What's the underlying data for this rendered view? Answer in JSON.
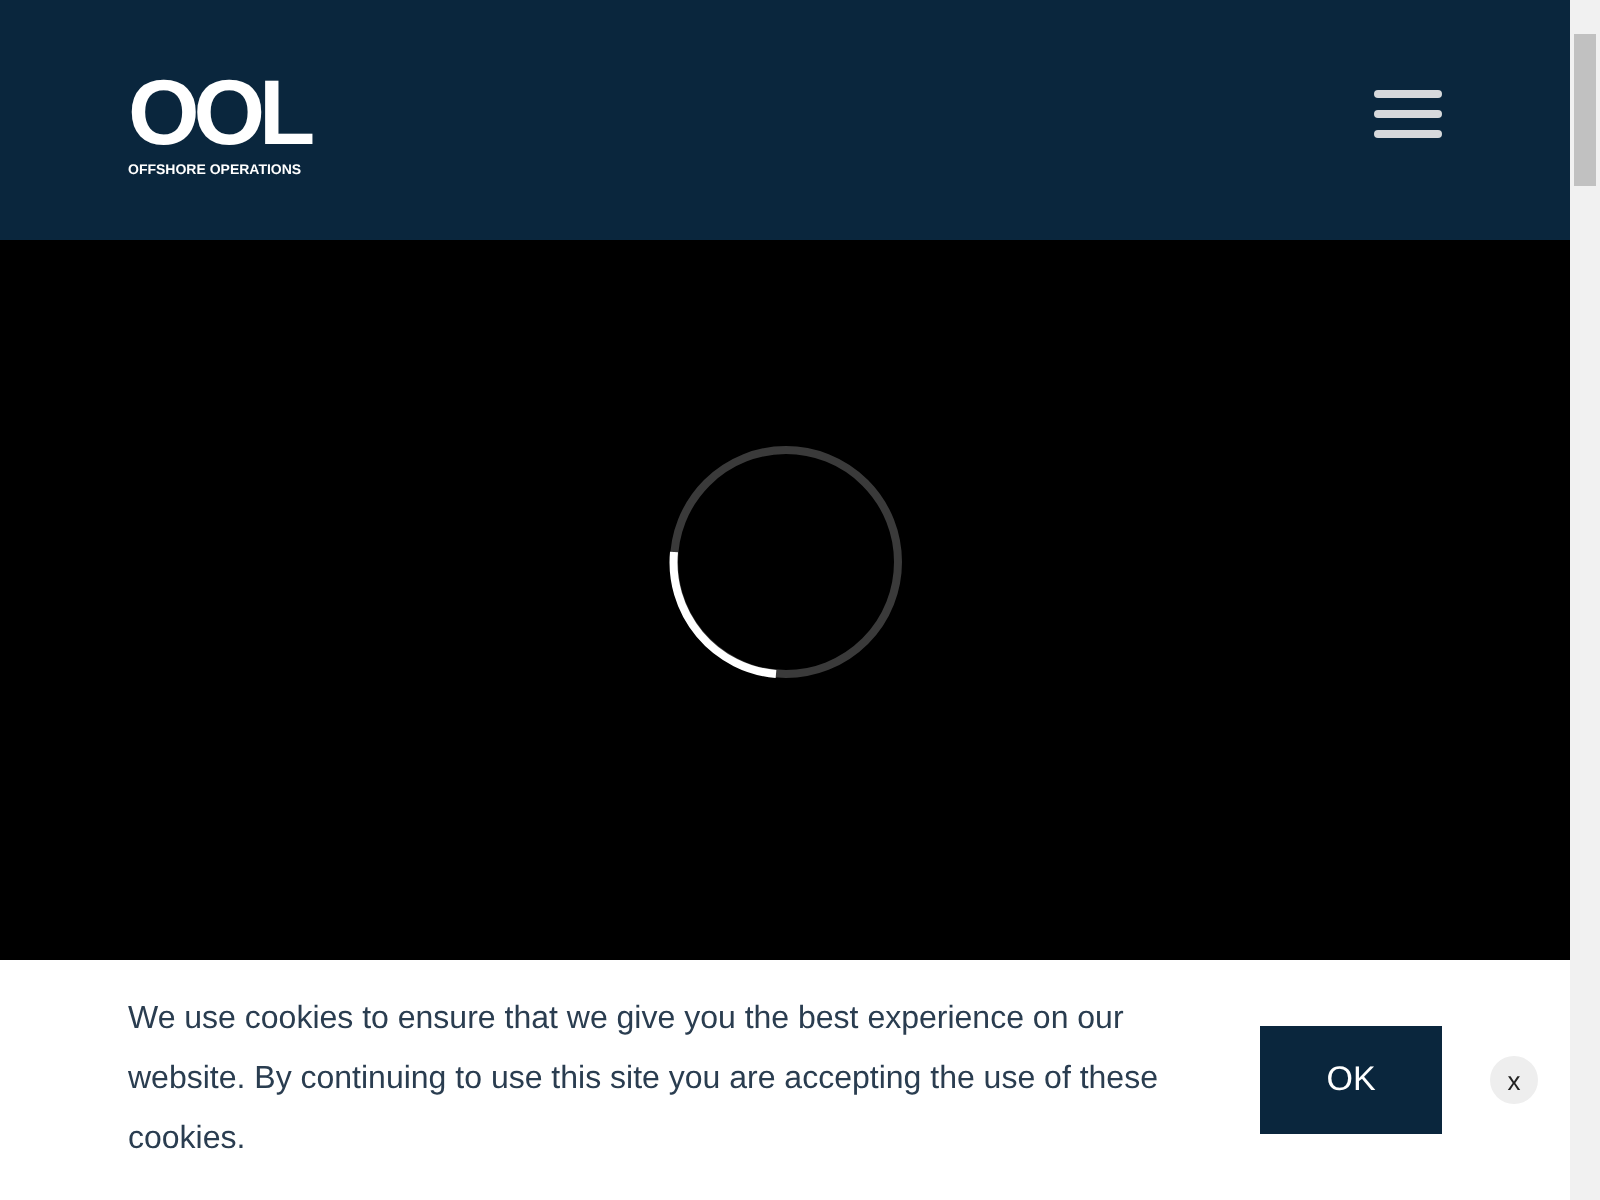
{
  "header": {
    "logo": {
      "mark": "OOL",
      "tagline": "OFFSHORE OPERATIONS"
    }
  },
  "cookie_banner": {
    "message": "We use cookies to ensure that we give you the best experience on our website. By continuing to use this site you are accepting the use of these cookies.",
    "accept_button": "OK",
    "close_button": "x"
  }
}
